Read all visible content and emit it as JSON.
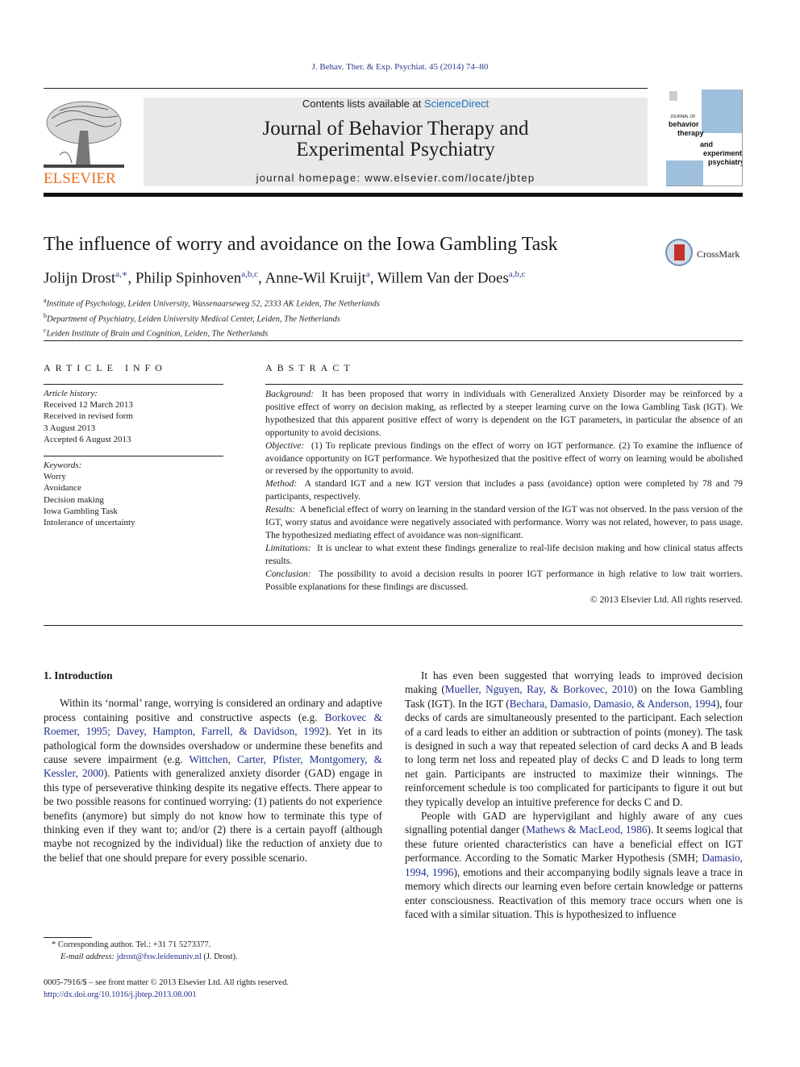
{
  "header": {
    "citation": "J. Behav. Ther. & Exp. Psychiat. 45 (2014) 74–80",
    "publisher_logo_text": "ELSEVIER",
    "contents_prefix": "Contents lists available at ",
    "contents_link": "ScienceDirect",
    "journal_title_line1": "Journal of Behavior Therapy and",
    "journal_title_line2": "Experimental Psychiatry",
    "homepage": "journal homepage: www.elsevier.com/locate/jbtep",
    "cover": {
      "kicker": "JOURNAL OF",
      "words": [
        "behavior",
        "therapy",
        "and",
        "experimental",
        "psychiatry"
      ],
      "accent": "#9ec0dc"
    },
    "brand_color": "#e9711c"
  },
  "article": {
    "title": "The influence of worry and avoidance on the Iowa Gambling Task",
    "crossmark_label": "CrossMark",
    "authors": [
      {
        "name": "Jolijn Drost",
        "sup": "a,∗",
        "sep": ", "
      },
      {
        "name": "Philip Spinhoven",
        "sup": "a,b,c",
        "sep": ", "
      },
      {
        "name": "Anne-Wil Kruijt",
        "sup": "a",
        "sep": ", "
      },
      {
        "name": "Willem Van der Does",
        "sup": "a,b,c",
        "sep": ""
      }
    ],
    "affiliations": [
      {
        "key": "a",
        "text": "Institute of Psychology, Leiden University, Wassenaarseweg 52, 2333 AK Leiden, The Netherlands"
      },
      {
        "key": "b",
        "text": "Department of Psychiatry, Leiden University Medical Center, Leiden, The Netherlands"
      },
      {
        "key": "c",
        "text": "Leiden Institute of Brain and Cognition, Leiden, The Netherlands"
      }
    ]
  },
  "article_info": {
    "heading": "ARTICLE INFO",
    "history_label": "Article history:",
    "history": [
      "Received 12 March 2013",
      "Received in revised form",
      "3 August 2013",
      "Accepted 6 August 2013"
    ],
    "keywords_label": "Keywords:",
    "keywords": [
      "Worry",
      "Avoidance",
      "Decision making",
      "Iowa Gambling Task",
      "Intolerance of uncertainty"
    ]
  },
  "abstract": {
    "heading": "ABSTRACT",
    "sections": [
      {
        "label": "Background:",
        "text": "It has been proposed that worry in individuals with Generalized Anxiety Disorder may be reinforced by a positive effect of worry on decision making, as reflected by a steeper learning curve on the Iowa Gambling Task (IGT). We hypothesized that this apparent positive effect of worry is dependent on the IGT parameters, in particular the absence of an opportunity to avoid decisions."
      },
      {
        "label": "Objective:",
        "text": "(1) To replicate previous findings on the effect of worry on IGT performance. (2) To examine the influence of avoidance opportunity on IGT performance. We hypothesized that the positive effect of worry on learning would be abolished or reversed by the opportunity to avoid."
      },
      {
        "label": "Method:",
        "text": "A standard IGT and a new IGT version that includes a pass (avoidance) option were completed by 78 and 79 participants, respectively."
      },
      {
        "label": "Results:",
        "text": "A beneficial effect of worry on learning in the standard version of the IGT was not observed. In the pass version of the IGT, worry status and avoidance were negatively associated with performance. Worry was not related, however, to pass usage. The hypothesized mediating effect of avoidance was non-significant."
      },
      {
        "label": "Limitations:",
        "text": "It is unclear to what extent these findings generalize to real-life decision making and how clinical status affects results."
      },
      {
        "label": "Conclusion:",
        "text": "The possibility to avoid a decision results in poorer IGT performance in high relative to low trait worriers. Possible explanations for these findings are discussed."
      }
    ],
    "copyright": "© 2013 Elsevier Ltd. All rights reserved."
  },
  "body": {
    "section_heading": "1.  Introduction",
    "left_paragraph": [
      {
        "t": "Within its ‘normal’ range, worrying is considered an ordinary and adaptive process containing positive and constructive aspects (e.g. "
      },
      {
        "link": "Borkovec & Roemer, 1995; Davey, Hampton, Farrell, & Davidson, 1992"
      },
      {
        "t": "). Yet in its pathological form the downsides overshadow or undermine these benefits and cause severe impairment (e.g. "
      },
      {
        "link": "Wittchen, Carter, Pfister, Montgomery, & Kessler, 2000"
      },
      {
        "t": "). Patients with generalized anxiety disorder (GAD) engage in this type of perseverative thinking despite its negative effects. There appear to be two possible reasons for continued worrying: (1) patients do not experience benefits (anymore) but simply do not know how to terminate this type of thinking even if they want to; and/or (2) there is a certain payoff (although maybe not recognized by the individual) like the reduction of anxiety due to the belief that one should prepare for every possible scenario."
      }
    ],
    "right_paragraph_1": [
      {
        "t": "It has even been suggested that worrying leads to improved decision making ("
      },
      {
        "link": "Mueller, Nguyen, Ray, & Borkovec, 2010"
      },
      {
        "t": ") on the Iowa Gambling Task (IGT). In the IGT ("
      },
      {
        "link": "Bechara, Damasio, Damasio, & Anderson, 1994"
      },
      {
        "t": "), four decks of cards are simultaneously presented to the participant. Each selection of a card leads to either an addition or subtraction of points (money). The task is designed in such a way that repeated selection of card decks A and B leads to long term net loss and repeated play of decks C and D leads to long term net gain. Participants are instructed to maximize their winnings. The reinforcement schedule is too complicated for participants to figure it out but they typically develop an intuitive preference for decks C and D."
      }
    ],
    "right_paragraph_2": [
      {
        "t": "People with GAD are hypervigilant and highly aware of any cues signalling potential danger ("
      },
      {
        "link": "Mathews & MacLeod, 1986"
      },
      {
        "t": "). It seems logical that these future oriented characteristics can have a beneficial effect on IGT performance. According to the Somatic Marker Hypothesis (SMH; "
      },
      {
        "link": "Damasio, 1994, 1996"
      },
      {
        "t": "), emotions and their accompanying bodily signals leave a trace in memory which directs our learning even before certain knowledge or patterns enter consciousness. Reactivation of this memory trace occurs when one is faced with a similar situation. This is hypothesized to influence"
      }
    ],
    "link_color": "#1f2f8c"
  },
  "footnotes": {
    "corresponding_marker": "*",
    "corresponding_text": "Corresponding author. Tel.: +31 71 5273377.",
    "email_label": "E-mail address:",
    "email": "jdrost@fsw.leidenuniv.nl",
    "email_suffix": "(J. Drost).",
    "front_matter": "0005-7916/$ – see front matter © 2013 Elsevier Ltd. All rights reserved.",
    "doi": "http://dx.doi.org/10.1016/j.jbtep.2013.08.001"
  }
}
